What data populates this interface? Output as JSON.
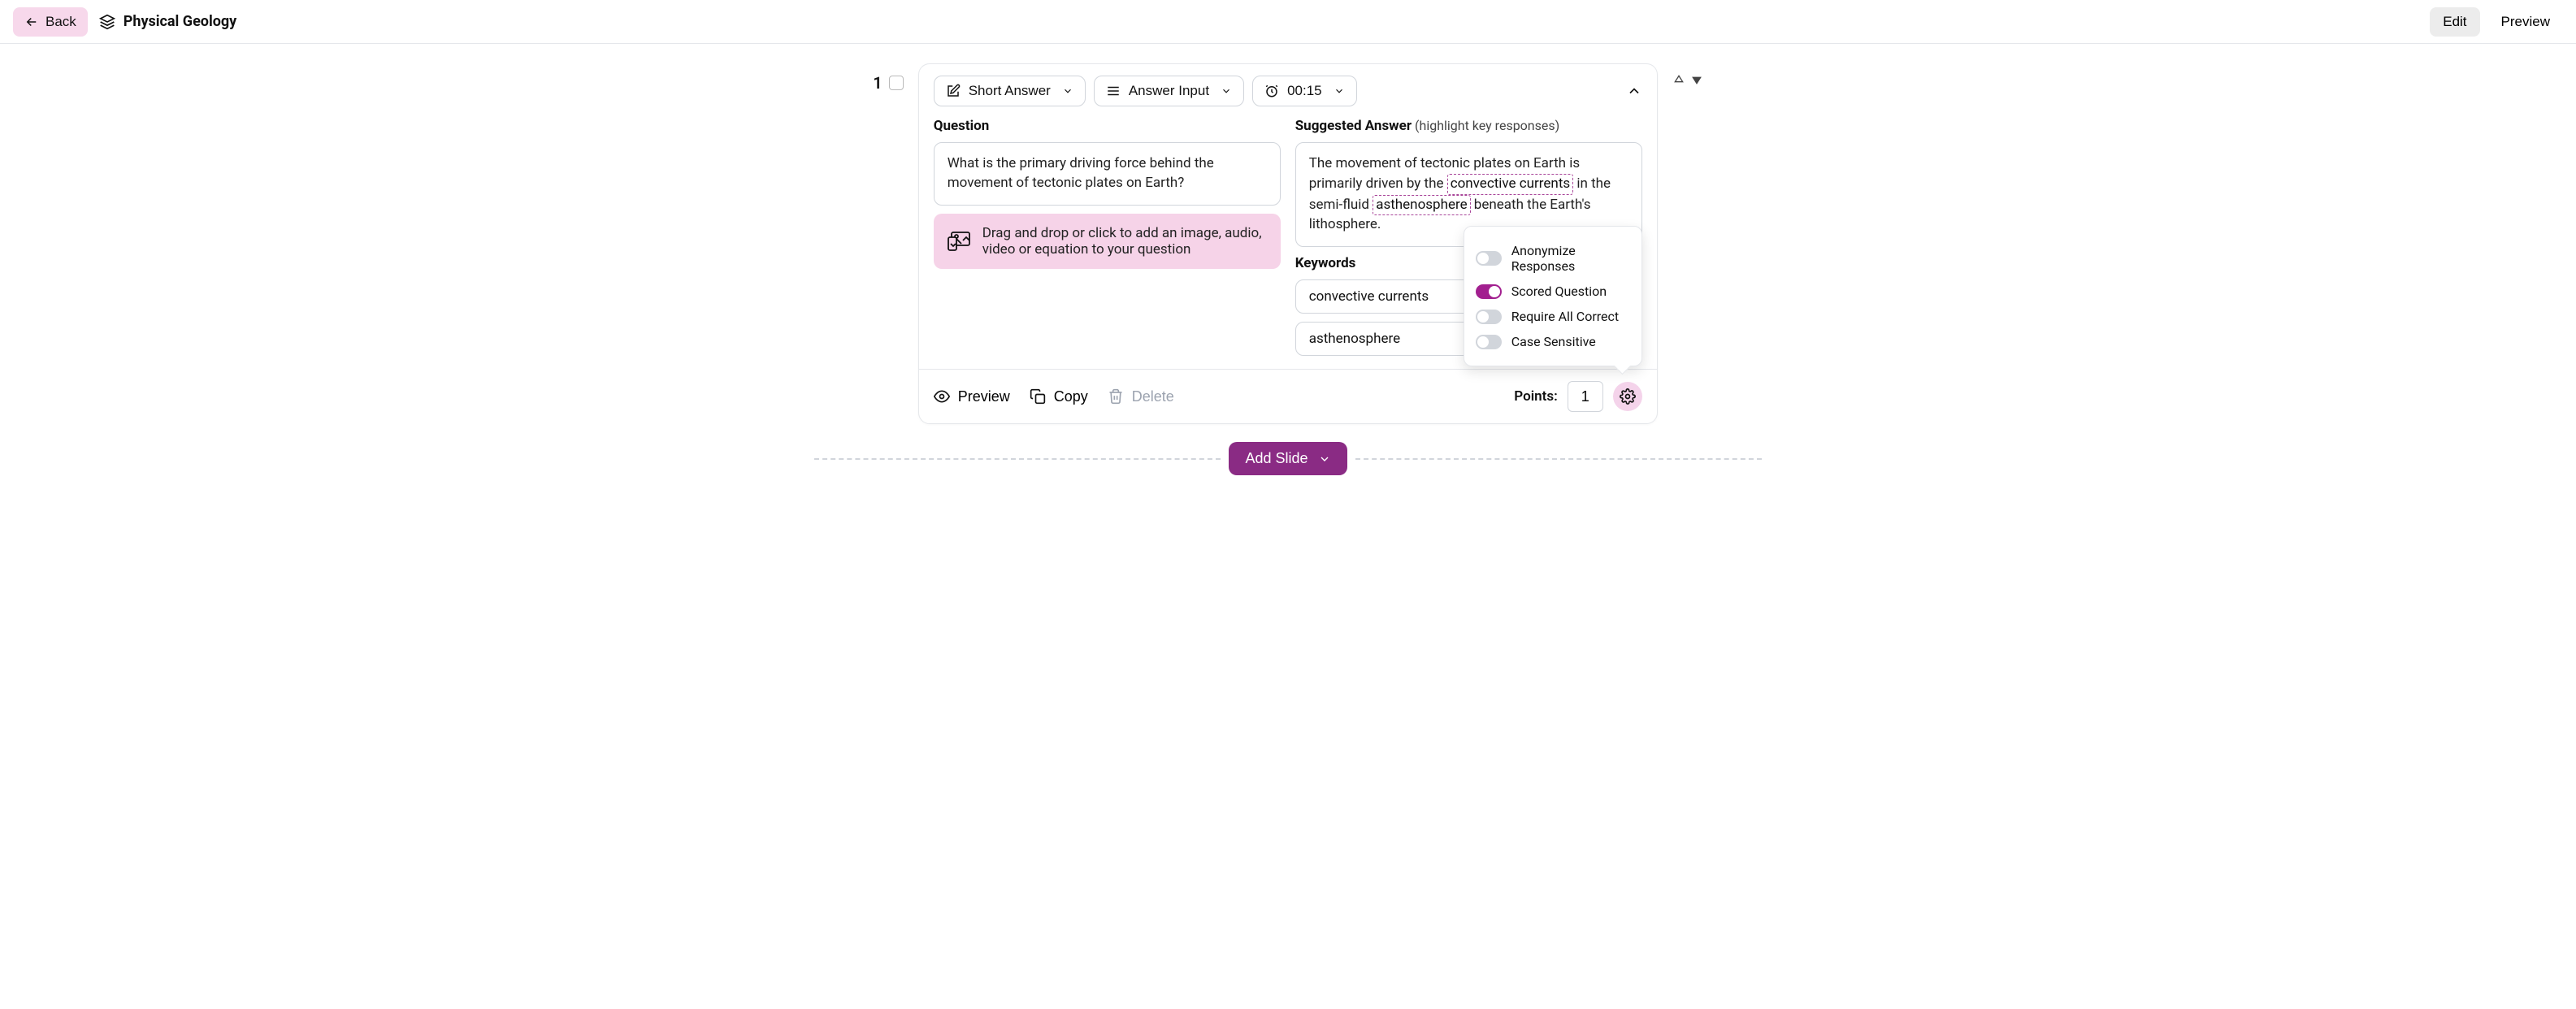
{
  "topbar": {
    "back_label": "Back",
    "title": "Physical Geology",
    "edit_label": "Edit",
    "preview_label": "Preview"
  },
  "slide": {
    "number": "1",
    "type_label": "Short Answer",
    "input_label": "Answer Input",
    "timer": "00:15",
    "question_label": "Question",
    "question_text": "What is the primary driving force behind the movement of tectonic plates on Earth?",
    "dropzone_text": "Drag and drop or click to add an image, audio, video or equation to your question",
    "answer_label": "Suggested Answer",
    "answer_note": "(highlight key responses)",
    "answer_pre": "The movement of tectonic plates on Earth is primarily driven by the ",
    "answer_hl1": "convective currents",
    "answer_mid1": " in the semi-fluid ",
    "answer_hl2": "asthenosphere",
    "answer_mid2": " beneath the Earth's lithosphere.",
    "keywords_label": "Keywords",
    "keywords": [
      "convective currents",
      "asthenosphere"
    ],
    "footer": {
      "preview": "Preview",
      "copy": "Copy",
      "delete": "Delete",
      "points_label": "Points:",
      "points_value": "1"
    },
    "settings": {
      "anonymize": {
        "label": "Anonymize Responses",
        "on": false
      },
      "scored": {
        "label": "Scored Question",
        "on": true
      },
      "require_all": {
        "label": "Require All Correct",
        "on": false
      },
      "case_sensitive": {
        "label": "Case Sensitive",
        "on": false
      }
    }
  },
  "add_slide_label": "Add Slide"
}
